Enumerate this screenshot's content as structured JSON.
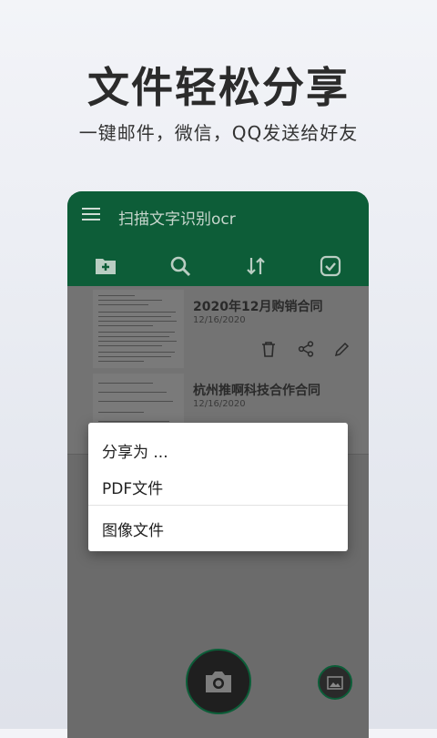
{
  "promo": {
    "headline": "文件轻松分享",
    "subline": "一键邮件，微信，QQ发送给好友"
  },
  "app": {
    "title": "扫描文字识别ocr",
    "accent": "#0d5d38"
  },
  "toolbar": {
    "icons": [
      "add-folder-icon",
      "search-icon",
      "sort-icon",
      "select-check-icon"
    ]
  },
  "documents": [
    {
      "title": "2020年12月购销合同",
      "date": "12/16/2020"
    },
    {
      "title": "杭州推啊科技合作合同",
      "date": "12/16/2020"
    }
  ],
  "share_dialog": {
    "title": "分享为 ...",
    "options": [
      "PDF文件",
      "图像文件"
    ]
  }
}
